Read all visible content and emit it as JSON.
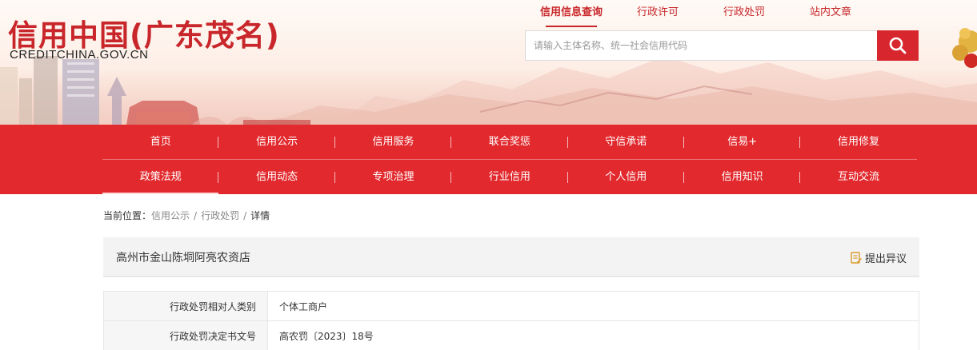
{
  "header": {
    "logo_cn": "信用中国(广东茂名)",
    "logo_en": "CREDITCHINA.GOV.CN",
    "top_links": [
      "信用信息查询",
      "行政许可",
      "行政处罚",
      "站内文章"
    ],
    "search_placeholder": "请输入主体名称、统一社会信用代码"
  },
  "nav": {
    "row1": [
      "首页",
      "信用公示",
      "信用服务",
      "联合奖惩",
      "守信承诺",
      "信易+",
      "信用修复"
    ],
    "row2": [
      "政策法规",
      "信用动态",
      "专项治理",
      "行业信用",
      "个人信用",
      "信用知识",
      "互动交流"
    ]
  },
  "breadcrumb": {
    "label": "当前位置：",
    "items": [
      "信用公示",
      "行政处罚"
    ],
    "current": "详情"
  },
  "detail": {
    "title": "高州市金山陈垌阿亮农资店",
    "objection_label": "提出异议",
    "rows": [
      {
        "key": "行政处罚相对人类别",
        "value": "个体工商户"
      },
      {
        "key": "行政处罚决定书文号",
        "value": "高农罚〔2023〕18号"
      }
    ]
  },
  "colors": {
    "brand_red": "#e2292d",
    "logo_red": "#c8262a"
  }
}
